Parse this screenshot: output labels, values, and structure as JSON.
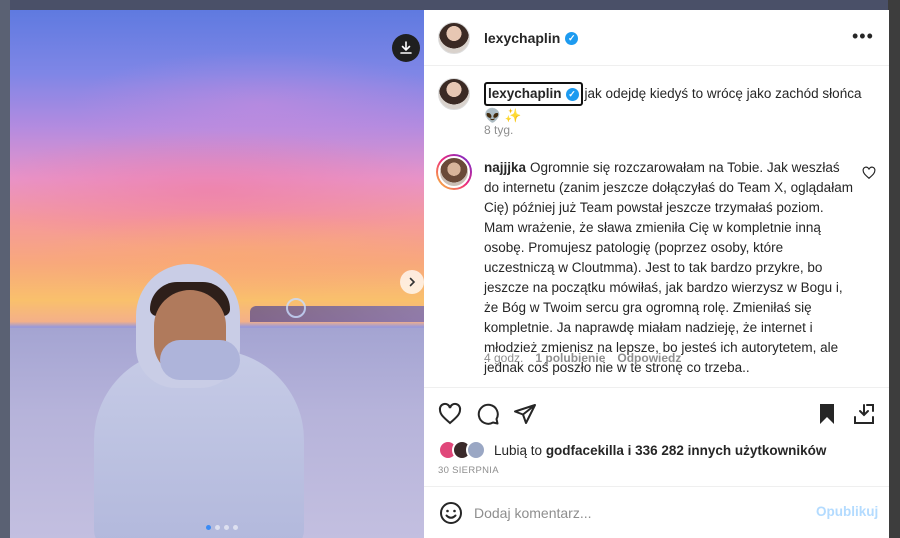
{
  "post": {
    "author": "lexychaplin",
    "caption_user": "lexychaplin",
    "caption_text": "jak odejdę kiedyś to wrócę jako zachód słońca 👽 ✨",
    "caption_time": "8 tyg.",
    "download_icon": "download-icon",
    "next_icon": "chevron-right-icon",
    "carousel_count": 4,
    "carousel_active_index": 0
  },
  "comment": {
    "user": "najjjka",
    "text": "Ogromnie się rozczarowałam na Tobie. Jak weszłaś do internetu (zanim jeszcze dołączyłaś do Team X, oglądałam Cię) później już Team powstał jeszcze trzymałaś poziom. Mam wrażenie, że sława zmieniła Cię w kompletnie inną osobę. Promujesz patologię (poprzez osoby, które uczestniczą w Cloutmma). Jest to tak bardzo przykre, bo jeszcze na początku mówiłaś, jak bardzo wierzysz w Bogu i, że Bóg w Twoim sercu gra ogromną rolę. Zmieniłaś się kompletnie. Ja naprawdę miałam nadzieję, że internet i młodzież zmienisz na lepsze, bo jesteś ich autorytetem, ale jednak coś poszło nie w te stronę co trzeba..",
    "time": "4 godz.",
    "likes": "1 polubienie",
    "reply": "Odpowiedz"
  },
  "likes": {
    "prefix": "Lubią to",
    "user": "godfacekilla",
    "suffix": "i 336 282 innych użytkowników"
  },
  "date": "30 SIERPNIA",
  "composer": {
    "placeholder": "Dodaj komentarz...",
    "publish": "Opublikuj"
  },
  "colors": {
    "verified": "#1d9bf0",
    "publish_disabled": "#b3dbff",
    "muted_text": "#8e8e8e"
  }
}
